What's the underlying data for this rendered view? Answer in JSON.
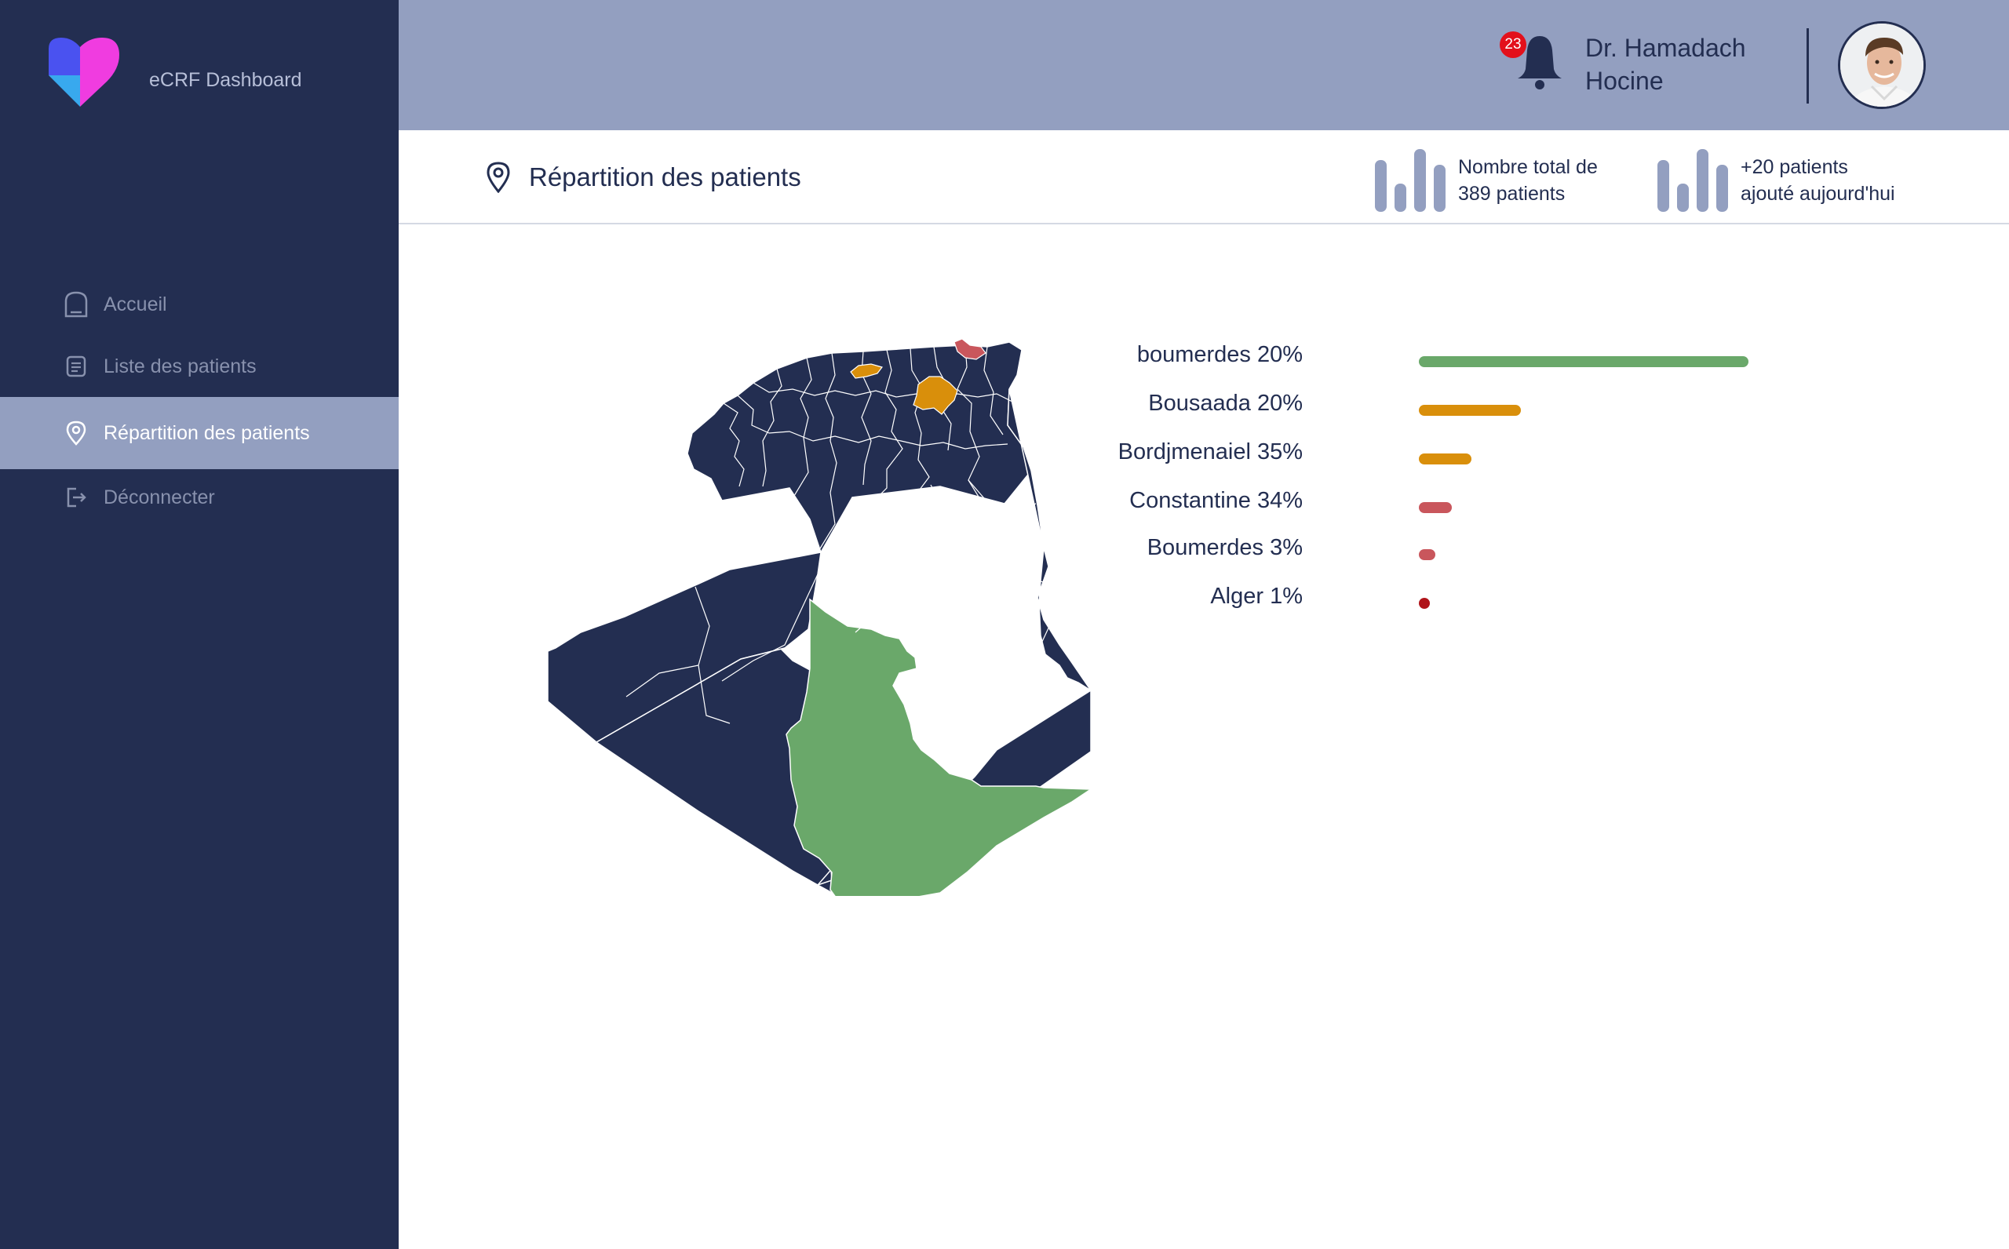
{
  "app": {
    "title": "eCRF Dashboard"
  },
  "sidebar": {
    "items": [
      {
        "label": "Accueil",
        "icon": "home-icon",
        "active": false
      },
      {
        "label": "Liste des patients",
        "icon": "list-icon",
        "active": false
      },
      {
        "label": "Répartition  des patients",
        "icon": "location-pin-icon",
        "active": true
      },
      {
        "label": "Déconnecter",
        "icon": "logout-icon",
        "active": false
      }
    ]
  },
  "header": {
    "notifications_count": "23",
    "user_name": "Dr. Hamadach Hocine"
  },
  "page": {
    "title": "Répartition des patients",
    "stats": [
      {
        "line1": "Nombre total de",
        "line2": "389 patients"
      },
      {
        "line1": "+20 patients",
        "line2": "ajouté aujourd'hui"
      }
    ]
  },
  "chart_data": {
    "type": "bar",
    "categories": [
      "boumerdes 20%",
      "Bousaada 20%",
      "Bordjmenaiel 35%",
      "Constantine 34%",
      "Boumerdes 3%",
      "Alger 1%"
    ],
    "values": [
      100,
      31,
      16,
      10,
      5,
      3
    ],
    "colors": [
      "#6aa86a",
      "#d98f0b",
      "#d98f0b",
      "#c9565c",
      "#c9565c",
      "#b0141a"
    ]
  },
  "colors": {
    "sidebar": "#232e51",
    "header": "#939fc0",
    "accent_green": "#6aa86a",
    "accent_orange": "#d98f0b",
    "accent_red": "#c9565c",
    "badge_red": "#e3101b"
  }
}
